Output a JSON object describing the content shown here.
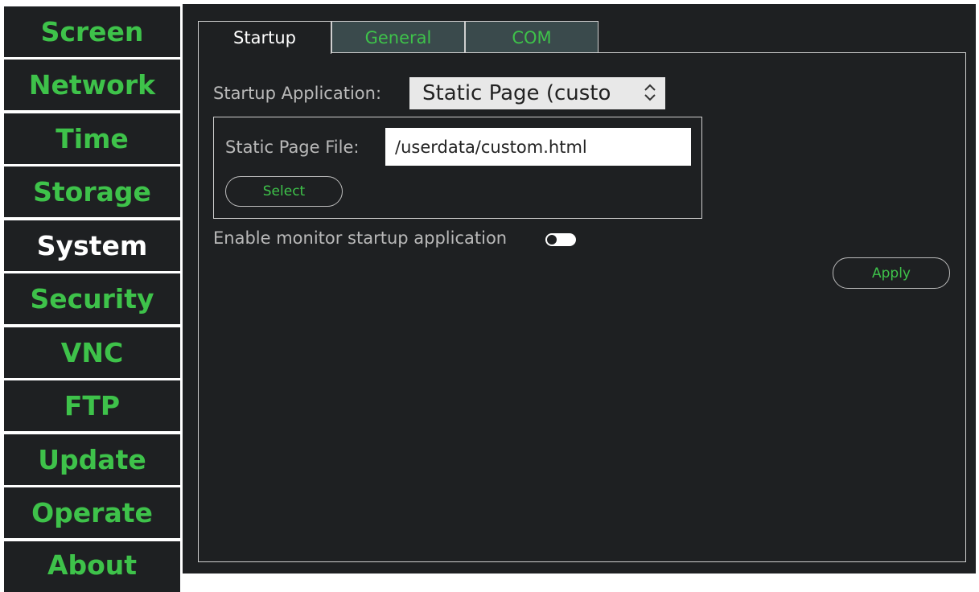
{
  "sidebar": {
    "items": [
      {
        "label": "Screen"
      },
      {
        "label": "Network"
      },
      {
        "label": "Time"
      },
      {
        "label": "Storage"
      },
      {
        "label": "System",
        "active": true
      },
      {
        "label": "Security"
      },
      {
        "label": "VNC"
      },
      {
        "label": "FTP"
      },
      {
        "label": "Update"
      },
      {
        "label": "Operate"
      },
      {
        "label": "About"
      }
    ]
  },
  "tabs": [
    {
      "label": "Startup",
      "active": true
    },
    {
      "label": "General"
    },
    {
      "label": "COM"
    }
  ],
  "startup": {
    "app_label": "Startup Application:",
    "app_value": "Static Page (custo",
    "static_file_label": "Static Page File:",
    "static_file_value": "/userdata/custom.html",
    "select_button": "Select",
    "monitor_label": "Enable monitor startup application",
    "monitor_enabled": false,
    "apply_button": "Apply"
  },
  "colors": {
    "background": "#1e2022",
    "accent": "#3ec24a",
    "active_text": "#ffffff",
    "inactive_tab": "#3a4a4c"
  },
  "icons": {
    "select_chevron": "chevron-up-down-icon"
  }
}
